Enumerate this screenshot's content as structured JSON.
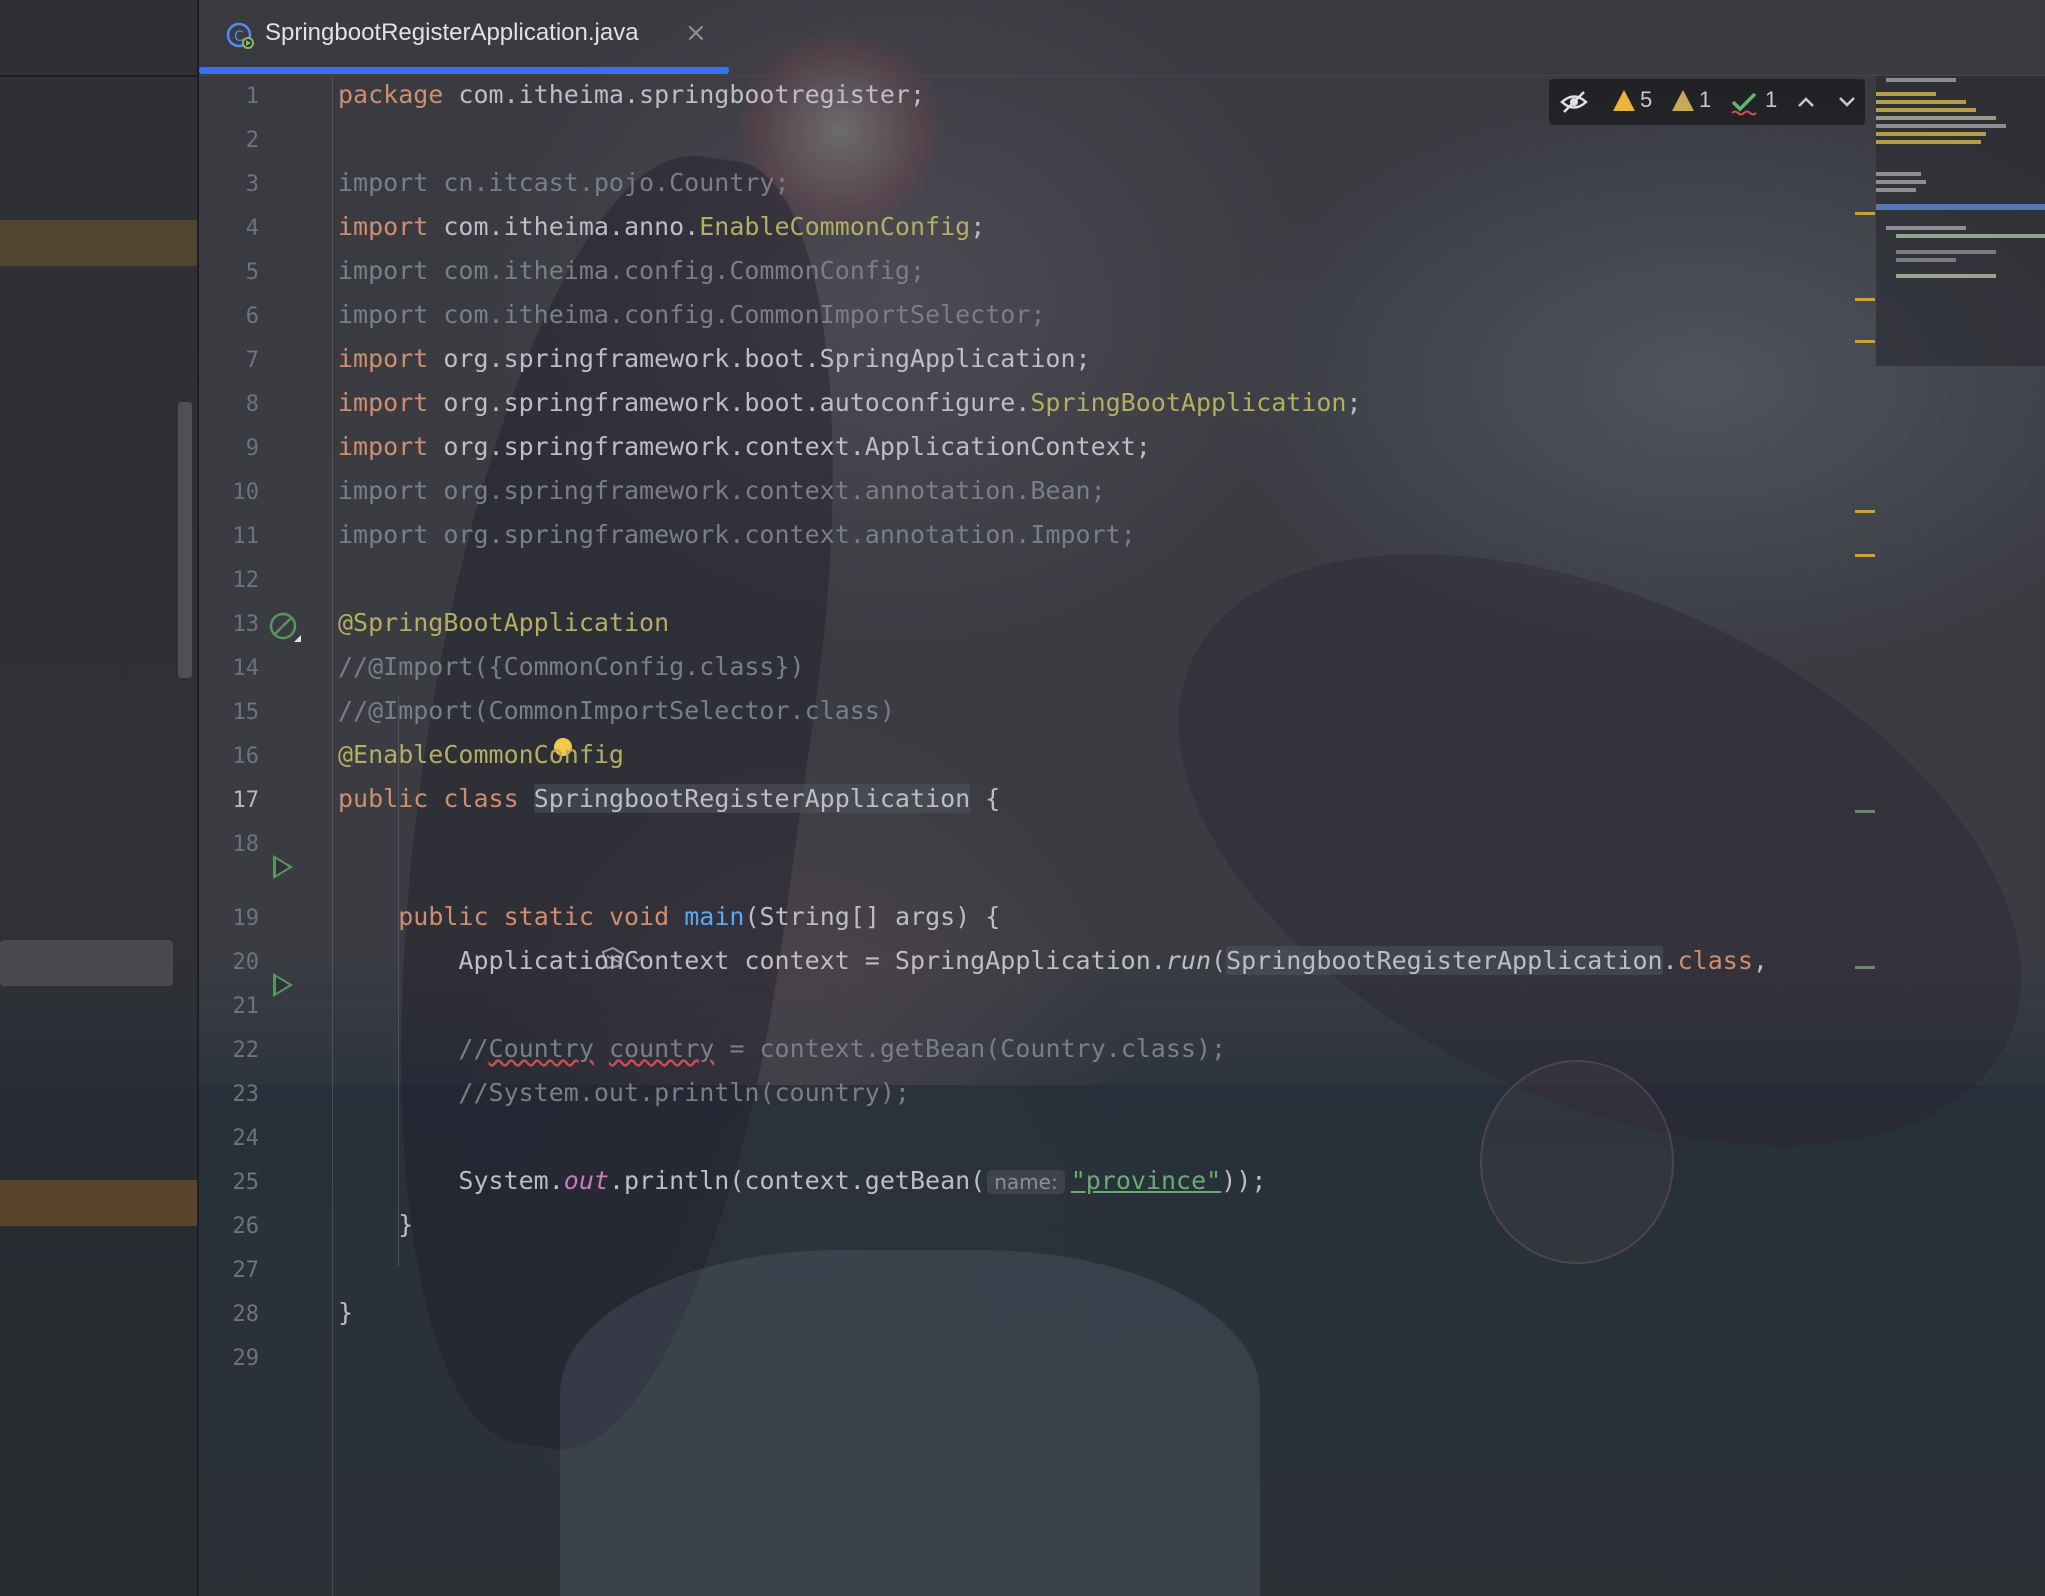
{
  "tab": {
    "title": "SpringbootRegisterApplication.java",
    "close_glyph": "×",
    "icon": "java-class-icon"
  },
  "inspections": {
    "warnings": "5",
    "weak_warnings": "1",
    "typos": "1",
    "reader_mode_icon": "eye-crossed-icon",
    "prev_icon": "chevron-up-icon",
    "next_icon": "chevron-down-icon"
  },
  "editor": {
    "line_numbers": [
      "1",
      "2",
      "3",
      "4",
      "5",
      "6",
      "7",
      "8",
      "9",
      "10",
      "11",
      "12",
      "13",
      "14",
      "15",
      "16",
      "17",
      "18",
      "19",
      "20",
      "21",
      "22",
      "23",
      "24",
      "25",
      "26",
      "27",
      "28",
      "29"
    ],
    "lines": {
      "l1": {
        "kw": "package",
        "rest": " com.itheima.springbootregister;"
      },
      "l3": {
        "text": "import cn.itcast.pojo.Country;"
      },
      "l4": {
        "kw": "import",
        "pkg": " com.itheima.anno.",
        "ann": "EnableCommonConfig",
        "end": ";"
      },
      "l5": {
        "text": "import com.itheima.config.CommonConfig;"
      },
      "l6": {
        "text": "import com.itheima.config.CommonImportSelector;"
      },
      "l7": {
        "kw": "import",
        "rest": " org.springframework.boot.SpringApplication;"
      },
      "l8": {
        "kw": "import",
        "pkg": " org.springframework.boot.autoconfigure.",
        "ann": "SpringBootApplication",
        "end": ";"
      },
      "l9": {
        "kw": "import",
        "rest": " org.springframework.context.ApplicationContext;"
      },
      "l10": {
        "text": "import org.springframework.context.annotation.Bean;"
      },
      "l11": {
        "text": "import org.springframework.context.annotation.Import;"
      },
      "l13": {
        "ann": "@SpringBootApplication"
      },
      "l14": {
        "text": "//@Import({CommonConfig.class})"
      },
      "l15": {
        "text": "//@Import(CommonImportSelector.class)"
      },
      "l16": {
        "ann": "@EnableCommonConfig"
      },
      "l17": {
        "kw1": "public",
        "kw2": "class",
        "name": "SpringbootRegisterApplication",
        "end": " {"
      },
      "l19": {
        "indent": "    ",
        "kw1": "public",
        "kw2": "static",
        "kw3": "void",
        "fn": "main",
        "args": "(String[] args) {"
      },
      "l20": {
        "indent": "        ",
        "a": "ApplicationContext context = SpringApplication.",
        "run": "run",
        "b": "(",
        "cls": "SpringbootRegisterApplication",
        "c": ".",
        "kw": "class",
        "d": ","
      },
      "l22": {
        "indent": "        ",
        "a": "//",
        "sq1": "Country",
        "b": " ",
        "sq2": "country",
        "c": " = context.getBean(Country.class);"
      },
      "l23": {
        "indent": "        ",
        "text": "//System.out.println(country);"
      },
      "l25": {
        "indent": "        ",
        "a": "System.",
        "out": "out",
        "b": ".println(context.getBean(",
        "hint": "name:",
        "str": "\"province\"",
        "c": "));"
      },
      "l26": {
        "indent": "    ",
        "text": "}"
      },
      "l28": {
        "text": "}"
      }
    }
  },
  "colors": {
    "keyword": "#cf8e6d",
    "annotation": "#b3ae60",
    "function": "#56a8f5",
    "string": "#6aab73",
    "comment": "#7a7e85",
    "accent": "#3574f0",
    "run_icon": "#57965c"
  }
}
